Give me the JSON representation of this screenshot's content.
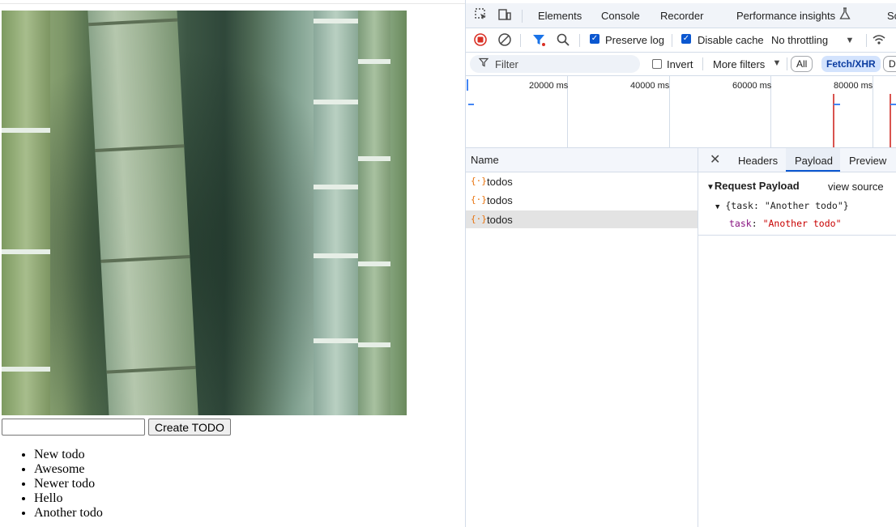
{
  "page": {
    "todo_input_value": "",
    "create_button_label": "Create TODO",
    "todos": [
      "New todo",
      "Awesome",
      "Newer todo",
      "Hello",
      "Another todo"
    ]
  },
  "devtools": {
    "tabs": [
      "Elements",
      "Console",
      "Recorder",
      "Performance insights",
      "Sc"
    ],
    "toolbar": {
      "preserve_log_label": "Preserve log",
      "preserve_log_checked": true,
      "disable_cache_label": "Disable cache",
      "disable_cache_checked": true,
      "throttling_value": "No throttling"
    },
    "filter": {
      "placeholder": "Filter",
      "invert_label": "Invert",
      "more_filters_label": "More filters",
      "type_filters": [
        "All",
        "Fetch/XHR",
        "Do"
      ]
    },
    "timeline_ticks": [
      "20000 ms",
      "40000 ms",
      "60000 ms",
      "80000 ms"
    ],
    "requests": {
      "column_header": "Name",
      "rows": [
        {
          "name": "todos",
          "selected": false
        },
        {
          "name": "todos",
          "selected": false
        },
        {
          "name": "todos",
          "selected": true
        }
      ]
    },
    "detail": {
      "tabs": [
        "Headers",
        "Payload",
        "Preview"
      ],
      "active_tab": "Payload",
      "section_title": "Request Payload",
      "view_source_label": "view source",
      "summary": "{task: \"Another todo\"}",
      "field_key": "task",
      "field_value": "\"Another todo\""
    },
    "colors": {
      "accent": "#0b57d0",
      "record_red": "#d93025",
      "filter_blue": "#1a73e8",
      "json_key": "#881280",
      "json_string": "#c80000"
    }
  }
}
